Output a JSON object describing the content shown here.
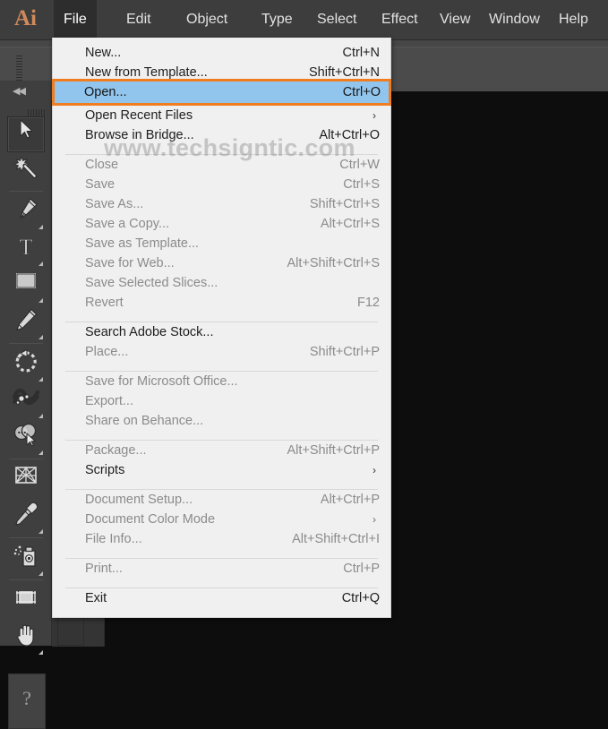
{
  "app": {
    "logo_text": "Ai",
    "logo_color": "#d08a5a"
  },
  "menubar": {
    "items": [
      {
        "label": "File",
        "active": true
      },
      {
        "label": "Edit",
        "active": false
      },
      {
        "label": "Object",
        "active": false
      },
      {
        "label": "Type",
        "active": false
      },
      {
        "label": "Select",
        "active": false
      },
      {
        "label": "Effect",
        "active": false
      },
      {
        "label": "View",
        "active": false
      },
      {
        "label": "Window",
        "active": false
      },
      {
        "label": "Help",
        "active": false
      }
    ]
  },
  "file_menu": {
    "highlight": {
      "label": "Open...",
      "shortcut": "Ctrl+O",
      "selection_fill": "#92c5ee",
      "outline_color": "#f07d20"
    },
    "items": [
      {
        "label": "New...",
        "shortcut": "Ctrl+N",
        "enabled": true,
        "submenu": false
      },
      {
        "label": "New from Template...",
        "shortcut": "Shift+Ctrl+N",
        "enabled": true,
        "submenu": false
      },
      {
        "label": "Open...",
        "shortcut": "Ctrl+O",
        "enabled": true,
        "submenu": false,
        "highlighted": true
      },
      {
        "label": "Open Recent Files",
        "shortcut": "",
        "enabled": true,
        "submenu": true
      },
      {
        "label": "Browse in Bridge...",
        "shortcut": "Alt+Ctrl+O",
        "enabled": true,
        "submenu": false
      },
      {
        "separator": true
      },
      {
        "label": "Close",
        "shortcut": "Ctrl+W",
        "enabled": false,
        "submenu": false
      },
      {
        "label": "Save",
        "shortcut": "Ctrl+S",
        "enabled": false,
        "submenu": false
      },
      {
        "label": "Save As...",
        "shortcut": "Shift+Ctrl+S",
        "enabled": false,
        "submenu": false
      },
      {
        "label": "Save a Copy...",
        "shortcut": "Alt+Ctrl+S",
        "enabled": false,
        "submenu": false
      },
      {
        "label": "Save as Template...",
        "shortcut": "",
        "enabled": false,
        "submenu": false
      },
      {
        "label": "Save for Web...",
        "shortcut": "Alt+Shift+Ctrl+S",
        "enabled": false,
        "submenu": false
      },
      {
        "label": "Save Selected Slices...",
        "shortcut": "",
        "enabled": false,
        "submenu": false
      },
      {
        "label": "Revert",
        "shortcut": "F12",
        "enabled": false,
        "submenu": false
      },
      {
        "separator": true
      },
      {
        "label": "Search Adobe Stock...",
        "shortcut": "",
        "enabled": true,
        "submenu": false
      },
      {
        "label": "Place...",
        "shortcut": "Shift+Ctrl+P",
        "enabled": false,
        "submenu": false
      },
      {
        "separator": true
      },
      {
        "label": "Save for Microsoft Office...",
        "shortcut": "",
        "enabled": false,
        "submenu": false
      },
      {
        "label": "Export...",
        "shortcut": "",
        "enabled": false,
        "submenu": false
      },
      {
        "label": "Share on Behance...",
        "shortcut": "",
        "enabled": false,
        "submenu": false
      },
      {
        "separator": true
      },
      {
        "label": "Package...",
        "shortcut": "Alt+Shift+Ctrl+P",
        "enabled": false,
        "submenu": false
      },
      {
        "label": "Scripts",
        "shortcut": "",
        "enabled": true,
        "submenu": true
      },
      {
        "separator": true
      },
      {
        "label": "Document Setup...",
        "shortcut": "Alt+Ctrl+P",
        "enabled": false,
        "submenu": false
      },
      {
        "label": "Document Color Mode",
        "shortcut": "",
        "enabled": false,
        "submenu": true
      },
      {
        "label": "File Info...",
        "shortcut": "Alt+Shift+Ctrl+I",
        "enabled": false,
        "submenu": false
      },
      {
        "separator": true
      },
      {
        "label": "Print...",
        "shortcut": "Ctrl+P",
        "enabled": false,
        "submenu": false
      },
      {
        "separator": true
      },
      {
        "label": "Exit",
        "shortcut": "Ctrl+Q",
        "enabled": true,
        "submenu": false
      }
    ]
  },
  "toolbar": {
    "collapse_glyph": "◀◀",
    "tools": [
      {
        "icon": "selection-arrow-icon",
        "selected": true,
        "has_flyout": false
      },
      {
        "icon": "magic-wand-icon",
        "selected": false,
        "has_flyout": false
      },
      {
        "icon": "pen-icon",
        "selected": false,
        "has_flyout": true
      },
      {
        "icon": "type-icon",
        "selected": false,
        "has_flyout": true
      },
      {
        "icon": "rectangle-icon",
        "selected": false,
        "has_flyout": true
      },
      {
        "icon": "pencil-icon",
        "selected": false,
        "has_flyout": true
      },
      {
        "icon": "rotate-icon",
        "selected": false,
        "has_flyout": true
      },
      {
        "icon": "width-warp-icon",
        "selected": false,
        "has_flyout": true
      },
      {
        "icon": "shape-builder-icon",
        "selected": false,
        "has_flyout": true
      },
      {
        "icon": "perspective-grid-icon",
        "selected": false,
        "has_flyout": false
      },
      {
        "icon": "eyedropper-icon",
        "selected": false,
        "has_flyout": true
      },
      {
        "icon": "symbol-sprayer-icon",
        "selected": false,
        "has_flyout": true
      },
      {
        "icon": "artboard-icon",
        "selected": false,
        "has_flyout": false
      },
      {
        "icon": "hand-icon",
        "selected": false,
        "has_flyout": true
      }
    ],
    "help_glyph": "?"
  },
  "statusbar": {
    "help_glyph": "?"
  },
  "watermark": {
    "text": "www.techsigntic.com"
  }
}
